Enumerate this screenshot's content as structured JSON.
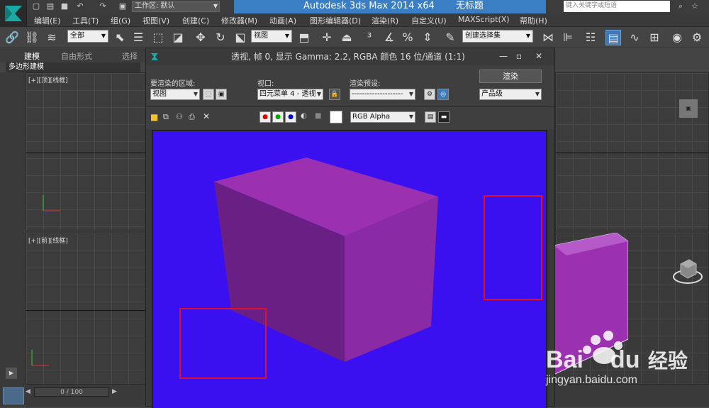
{
  "app": {
    "title_name": "Autodesk 3ds Max  2014 x64",
    "file_name": "无标题",
    "workspace_label": "工作区: 默认",
    "search_placeholder": "键入关键字或短语"
  },
  "menu": [
    "编辑(E)",
    "工具(T)",
    "组(G)",
    "视图(V)",
    "创建(C)",
    "修改器(M)",
    "动画(A)",
    "图形编辑器(D)",
    "渲染(R)",
    "自定义(U)",
    "MAXScript(X)",
    "帮助(H)"
  ],
  "toolbar": {
    "selection_filter": "全部",
    "ref_coord": "视图",
    "named_selection": "创建选择集"
  },
  "ribbon": {
    "tabs": [
      "建模",
      "自由形式",
      "选择"
    ],
    "sub_label": "多边形建模"
  },
  "viewports": {
    "top_label": "[+][顶][线框]",
    "front_label": "[+][前][线框]"
  },
  "timeline": {
    "frame": "0 / 100"
  },
  "render_window": {
    "title": "透视, 帧 0, 显示 Gamma: 2.2, RGBA 颜色 16 位/通道 (1:1)",
    "area_label": "要渲染的区域:",
    "area_value": "视图",
    "viewport_label": "视口:",
    "viewport_value": "四元菜单 4 - 透视",
    "preset_label": "渲染预设:",
    "preset_value": "--------------------",
    "render_button": "渲染",
    "quality_value": "产品级",
    "channel_value": "RGB Alpha",
    "render_bg_color": "#3b10f0",
    "box_color": "#9b30b0",
    "highlight_color": "#e0102a"
  },
  "watermark": {
    "brand_text": "Bai",
    "brand_tail": "du",
    "site_suffix": "经验",
    "url": "jingyan.baidu.com"
  }
}
